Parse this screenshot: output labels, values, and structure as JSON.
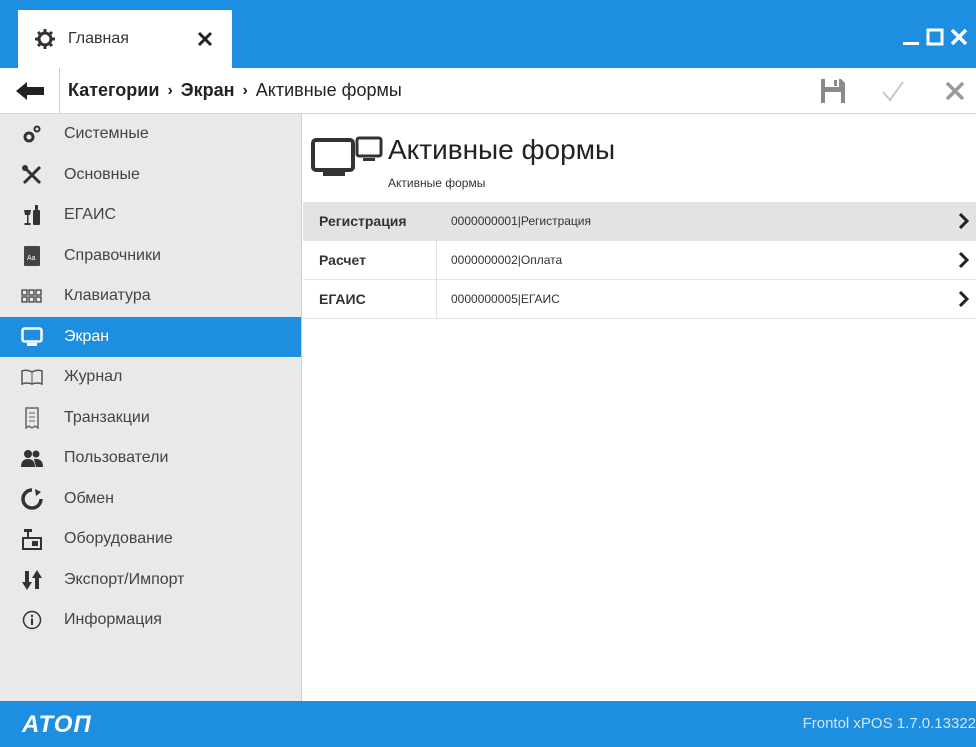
{
  "window": {
    "tab_label": "Главная",
    "tab_icon": "gear-icon",
    "controls": [
      "minimize-icon",
      "maximize-icon",
      "close-icon"
    ]
  },
  "breadcrumb": {
    "items": [
      "Категории",
      "Экран",
      "Активные формы"
    ],
    "separator": "›"
  },
  "toolbar": {
    "buttons": [
      "save-icon",
      "check-icon",
      "cancel-icon"
    ]
  },
  "sidebar": {
    "items": [
      {
        "label": "Системные",
        "icon": "gears-icon"
      },
      {
        "label": "Основные",
        "icon": "tools-icon"
      },
      {
        "label": "ЕГАИС",
        "icon": "bottles-icon"
      },
      {
        "label": "Справочники",
        "icon": "book-icon"
      },
      {
        "label": "Клавиатура",
        "icon": "keyboard-icon"
      },
      {
        "label": "Экран",
        "icon": "monitor-icon"
      },
      {
        "label": "Журнал",
        "icon": "journal-icon"
      },
      {
        "label": "Транзакции",
        "icon": "receipt-icon"
      },
      {
        "label": "Пользователи",
        "icon": "users-icon"
      },
      {
        "label": "Обмен",
        "icon": "sync-icon"
      },
      {
        "label": "Оборудование",
        "icon": "cash-register-icon"
      },
      {
        "label": "Экспорт/Импорт",
        "icon": "export-import-icon"
      },
      {
        "label": "Информация",
        "icon": "info-icon"
      }
    ],
    "active_index": 5
  },
  "content": {
    "title": "Активные формы",
    "subtitle": "Активные формы",
    "rows": [
      {
        "key": "Регистрация",
        "value": "0000000001|Регистрация",
        "selected": true
      },
      {
        "key": "Расчет",
        "value": "0000000002|Оплата",
        "selected": false
      },
      {
        "key": "ЕГАИС",
        "value": "0000000005|ЕГАИС",
        "selected": false
      }
    ]
  },
  "footer": {
    "logo": "ATOΠ",
    "version": "Frontol xPOS 1.7.0.13322"
  },
  "colors": {
    "accent": "#1e8fe0",
    "sidebar_bg": "#e9e9e9",
    "selected_row": "#e3e3e3"
  }
}
